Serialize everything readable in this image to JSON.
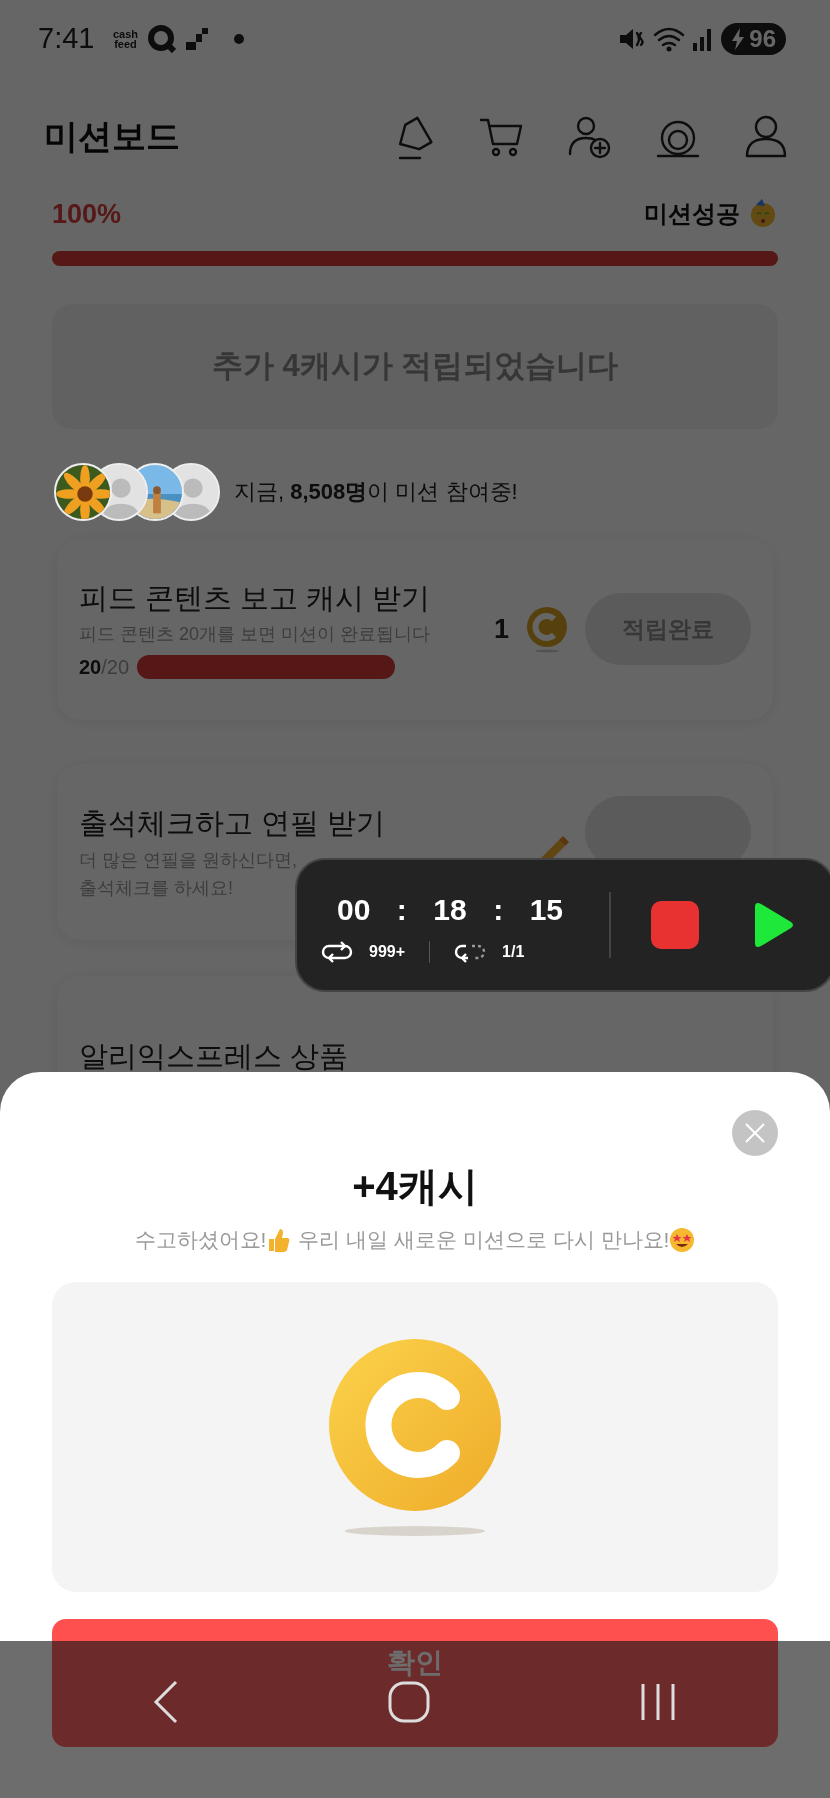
{
  "status_bar": {
    "time": "7:41",
    "app_badge": "cash feed",
    "battery": "96"
  },
  "header": {
    "title": "미션보드"
  },
  "progress": {
    "percent": "100%",
    "label": "미션성공",
    "level": 1
  },
  "banner": {
    "text": "추가 4캐시가 적립되었습니다"
  },
  "participants": {
    "avatars": [
      {
        "kind": "picture"
      },
      {
        "kind": "silhouette"
      },
      {
        "kind": "picture"
      },
      {
        "kind": "silhouette"
      }
    ],
    "text": "지금, **8,508명**이 미션 참여중!"
  },
  "missions": [
    {
      "title": "피드 콘텐츠 보고 캐시 받기",
      "description": [
        "피드 콘텐츠 20개를 보면 미션이 완료됩니다"
      ],
      "count": "20",
      "total": "/20",
      "level": 1,
      "reward": "1",
      "kind": "coin",
      "button": "적립완료",
      "disabled": true
    },
    {
      "title": "출석체크하고 연필 받기",
      "description": [
        "더 많은 연필을 원하신다면,",
        "출석체크를 하세요!"
      ],
      "kind": "pencil",
      "disabled": true
    },
    {
      "title": "알리익스프레스 상품"
    }
  ],
  "recorder": {
    "time_parts": [
      "00",
      ":",
      "18",
      ":",
      "15"
    ],
    "loop_count": "999+",
    "repeat_count": "1/1"
  },
  "dialog": {
    "title": "+4캐시",
    "message_parts": [
      "수고하셨어요!",
      "우리 내일 새로운 미션으로 다시 만나요!"
    ],
    "confirm": "확인"
  }
}
